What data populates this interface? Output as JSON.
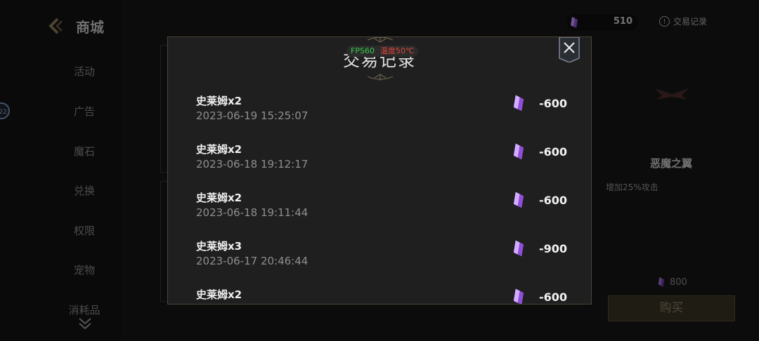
{
  "header": {
    "title": "商城",
    "currency_amount": "510",
    "records_link": "交易记录",
    "info_glyph": "!"
  },
  "sidebar": {
    "items": [
      "活动",
      "广告",
      "魔石",
      "兑换",
      "权限",
      "宠物",
      "消耗品"
    ]
  },
  "edge_badge": "22",
  "item": {
    "name": "恶魔之翼",
    "desc": "增加25%攻击",
    "price": "800",
    "buy_label": "购买"
  },
  "modal": {
    "title": "交易记录",
    "fps": "FPS60",
    "temp": "温度50℃",
    "records": [
      {
        "name": "史莱姆x2",
        "time": "2023-06-19 15:25:07",
        "amount": "-600"
      },
      {
        "name": "史莱姆x2",
        "time": "2023-06-18 19:12:17",
        "amount": "-600"
      },
      {
        "name": "史莱姆x2",
        "time": "2023-06-18 19:11:44",
        "amount": "-600"
      },
      {
        "name": "史莱姆x3",
        "time": "2023-06-17 20:46:44",
        "amount": "-900"
      },
      {
        "name": "史莱姆x2",
        "time": "",
        "amount": "-600"
      }
    ]
  },
  "icons": {
    "gem": "purple-crystal-icon",
    "close": "close-icon",
    "back": "back-arrow-icon",
    "more": "double-chevron-down-icon"
  },
  "colors": {
    "gem": "#9b5de5",
    "positive_fps": "#37c84a",
    "temperature": "#e0463c",
    "border": "#4d4538"
  }
}
